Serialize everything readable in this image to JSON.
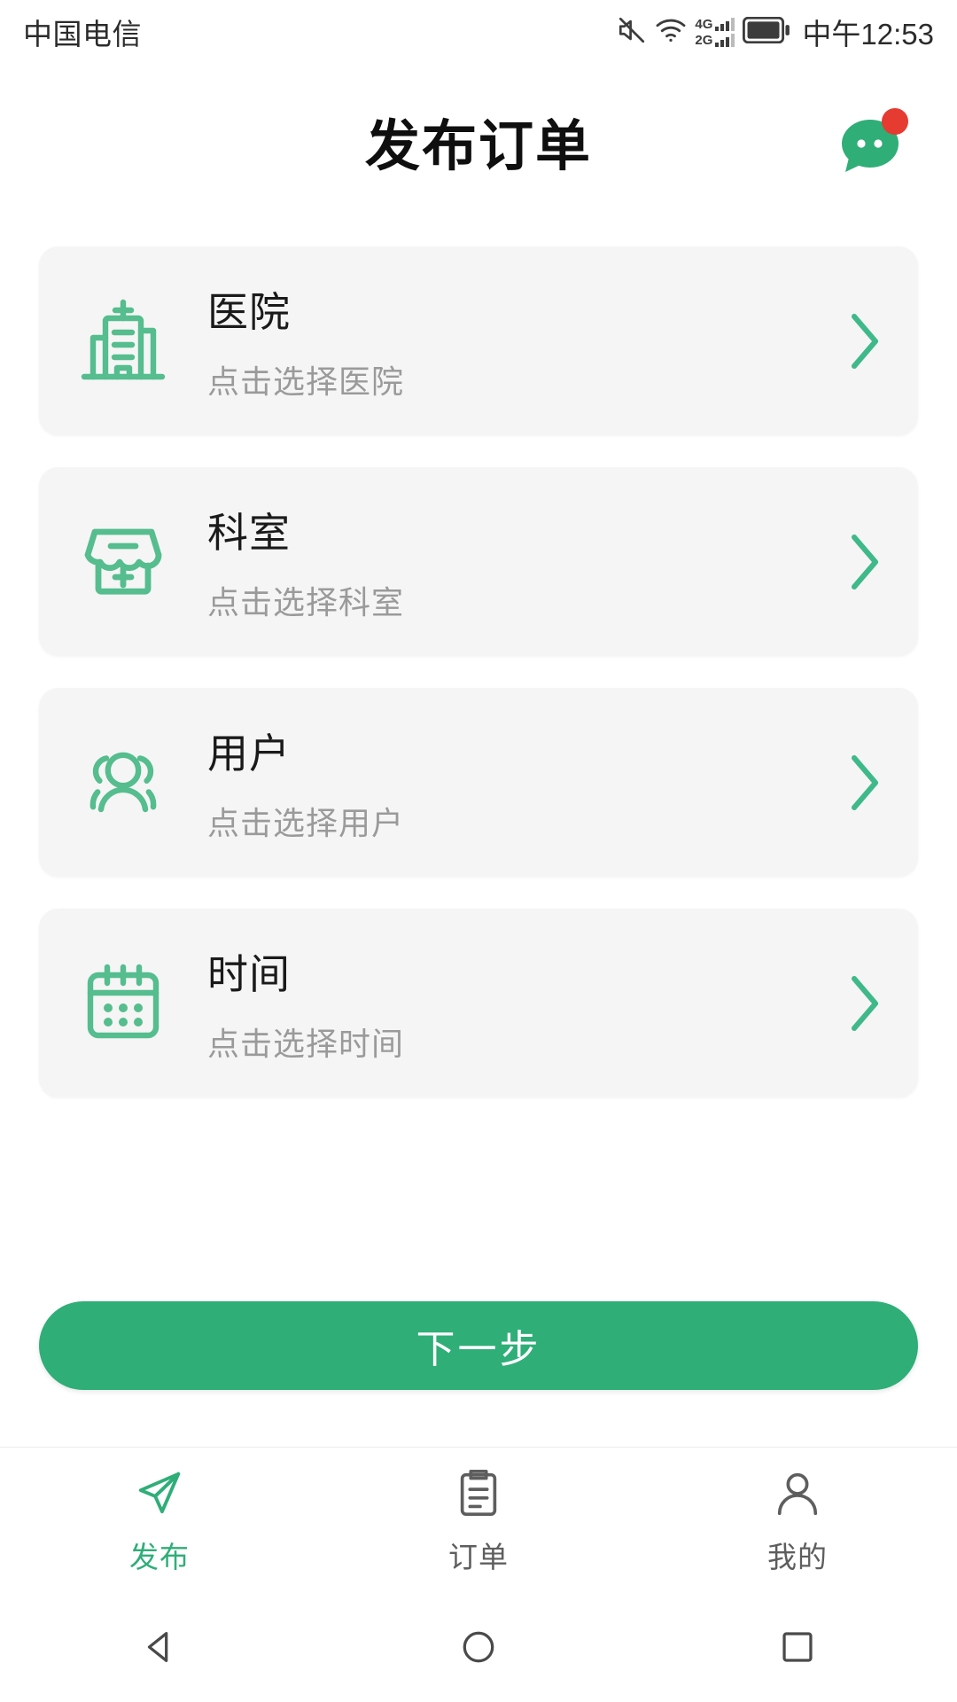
{
  "status_bar": {
    "carrier": "中国电信",
    "time": "中午12:53",
    "signal_primary": "4G",
    "signal_secondary": "2G",
    "icons": [
      "mute-icon",
      "wifi-icon",
      "signal-icon",
      "battery-icon"
    ]
  },
  "header": {
    "title": "发布订单",
    "chat_icon": "chat-bubble-icon",
    "has_badge": true
  },
  "cards": [
    {
      "icon": "hospital-icon",
      "title": "医院",
      "subtitle": "点击选择医院",
      "chevron": "chevron-right-icon"
    },
    {
      "icon": "clinic-icon",
      "title": "科室",
      "subtitle": "点击选择科室",
      "chevron": "chevron-right-icon"
    },
    {
      "icon": "users-icon",
      "title": "用户",
      "subtitle": "点击选择用户",
      "chevron": "chevron-right-icon"
    },
    {
      "icon": "calendar-icon",
      "title": "时间",
      "subtitle": "点击选择时间",
      "chevron": "chevron-right-icon"
    }
  ],
  "primary_button": {
    "label": "下一步"
  },
  "tabbar": {
    "items": [
      {
        "label": "发布",
        "icon": "paper-plane-icon",
        "active": true
      },
      {
        "label": "订单",
        "icon": "clipboard-icon",
        "active": false
      },
      {
        "label": "我的",
        "icon": "person-icon",
        "active": false
      }
    ]
  },
  "system_nav": {
    "back": "back-triangle-icon",
    "home": "home-circle-icon",
    "recents": "recents-square-icon"
  },
  "colors": {
    "accent": "#2fae78",
    "icon_green": "#55bd8e",
    "badge_red": "#e63b31",
    "card_bg": "#f5f5f5",
    "title": "#0f0f0f",
    "subtitle": "#9a9a9a"
  }
}
